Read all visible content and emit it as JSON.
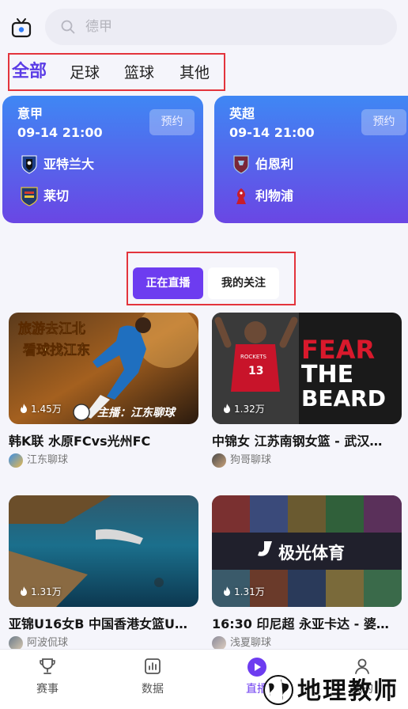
{
  "search": {
    "placeholder": "德甲",
    "icon": "search-icon"
  },
  "categories": [
    {
      "label": "全部",
      "active": true
    },
    {
      "label": "足球"
    },
    {
      "label": "篮球"
    },
    {
      "label": "其他"
    }
  ],
  "matches": [
    {
      "league": "意甲",
      "time": "09-14 21:00",
      "book_label": "预约",
      "home": "亚特兰大",
      "away": "莱切"
    },
    {
      "league": "英超",
      "time": "09-14 21:00",
      "book_label": "预约",
      "home": "伯恩利",
      "away": "利物浦"
    }
  ],
  "live_tabs": {
    "live": "正在直播",
    "follow": "我的关注"
  },
  "videos": [
    {
      "views": "1.45万",
      "title": "韩K联  水原FCvs光州FC",
      "author": "江东聊球",
      "overlay_top1": "旅游去江北",
      "overlay_top2": "看球找江东",
      "overlay_bottom": "主播：江东聊球"
    },
    {
      "views": "1.32万",
      "title": "中锦女  江苏南钢女篮 - 武汉…",
      "author": "狗哥聊球",
      "overlay_fear": "FEAR",
      "overlay_the": "THE",
      "overlay_beard": "BEARD",
      "jersey": "13",
      "shirt_text": "ROCKETS"
    },
    {
      "views": "1.31万",
      "title": "亚锦U16女B 中国香港女篮U…",
      "author": "阿波侃球"
    },
    {
      "views": "1.31万",
      "title": "16:30 印尼超 永亚卡达 - 婆…",
      "author": "浅夏聊球",
      "overlay_brand": "极光体育"
    }
  ],
  "tabbar": [
    {
      "label": "赛事",
      "icon": "trophy-icon"
    },
    {
      "label": "数据",
      "icon": "chart-icon"
    },
    {
      "label": "直播",
      "icon": "play-icon",
      "active": true
    },
    {
      "label": "我的",
      "icon": "user-icon"
    }
  ],
  "watermark": {
    "text": "地理教师"
  },
  "colors": {
    "accent": "#6d3cf0",
    "card_top": "#3f87f4",
    "card_bottom": "#6a46e4",
    "highlight_box": "#e3343c"
  }
}
